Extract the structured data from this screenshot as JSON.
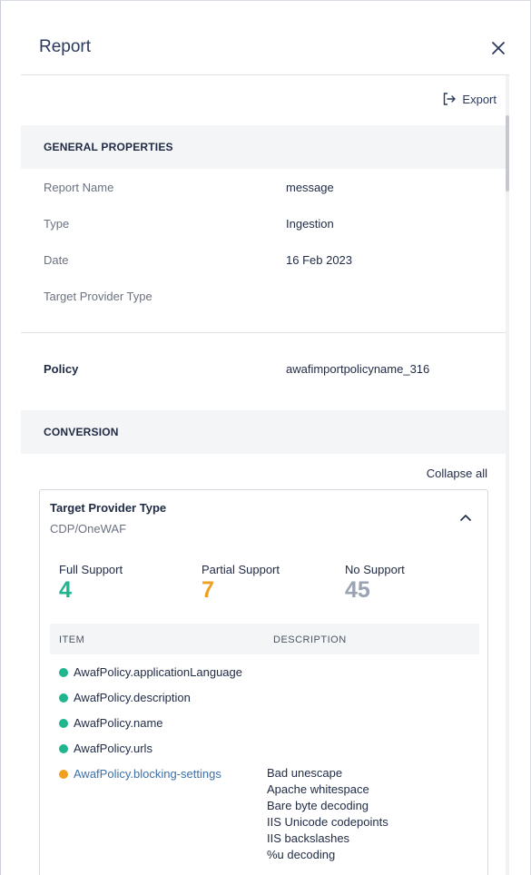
{
  "header": {
    "title": "Report",
    "close_icon": "close-icon"
  },
  "toolbar": {
    "export_label": "Export",
    "export_icon": "export-icon"
  },
  "general": {
    "heading": "GENERAL PROPERTIES",
    "rows": [
      {
        "key": "Report Name",
        "value": "message"
      },
      {
        "key": "Type",
        "value": "Ingestion"
      },
      {
        "key": "Date",
        "value": "16 Feb 2023"
      },
      {
        "key": "Target Provider Type",
        "value": ""
      }
    ]
  },
  "policy": {
    "key": "Policy",
    "value": "awafimportpolicyname_316"
  },
  "conversion": {
    "heading": "CONVERSION",
    "collapse_all_label": "Collapse all",
    "card": {
      "title": "Target Provider Type",
      "subtitle": "CDP/OneWAF",
      "chevron_icon": "chevron-up-icon",
      "stats": [
        {
          "label": "Full Support",
          "value": "4",
          "color": "#1fb58f"
        },
        {
          "label": "Partial Support",
          "value": "7",
          "color": "#f0a020"
        },
        {
          "label": "No Support",
          "value": "45",
          "color": "#9aa3b2"
        }
      ],
      "table": {
        "columns": [
          "ITEM",
          "DESCRIPTION"
        ],
        "rows": [
          {
            "item": "AwafPolicy.applicationLanguage",
            "status": "full"
          },
          {
            "item": "AwafPolicy.description",
            "status": "full"
          },
          {
            "item": "AwafPolicy.name",
            "status": "full"
          },
          {
            "item": "AwafPolicy.urls",
            "status": "full"
          },
          {
            "item": "AwafPolicy.blocking-settings",
            "status": "partial",
            "description": [
              "Bad unescape",
              "Apache whitespace",
              "Bare byte decoding",
              "IIS Unicode codepoints",
              "IIS backslashes",
              "%u decoding"
            ]
          }
        ]
      }
    }
  },
  "colors": {
    "full": "#1fb58f",
    "partial": "#f0a020",
    "none": "#9aa3b2",
    "link": "#3d6fa8"
  }
}
